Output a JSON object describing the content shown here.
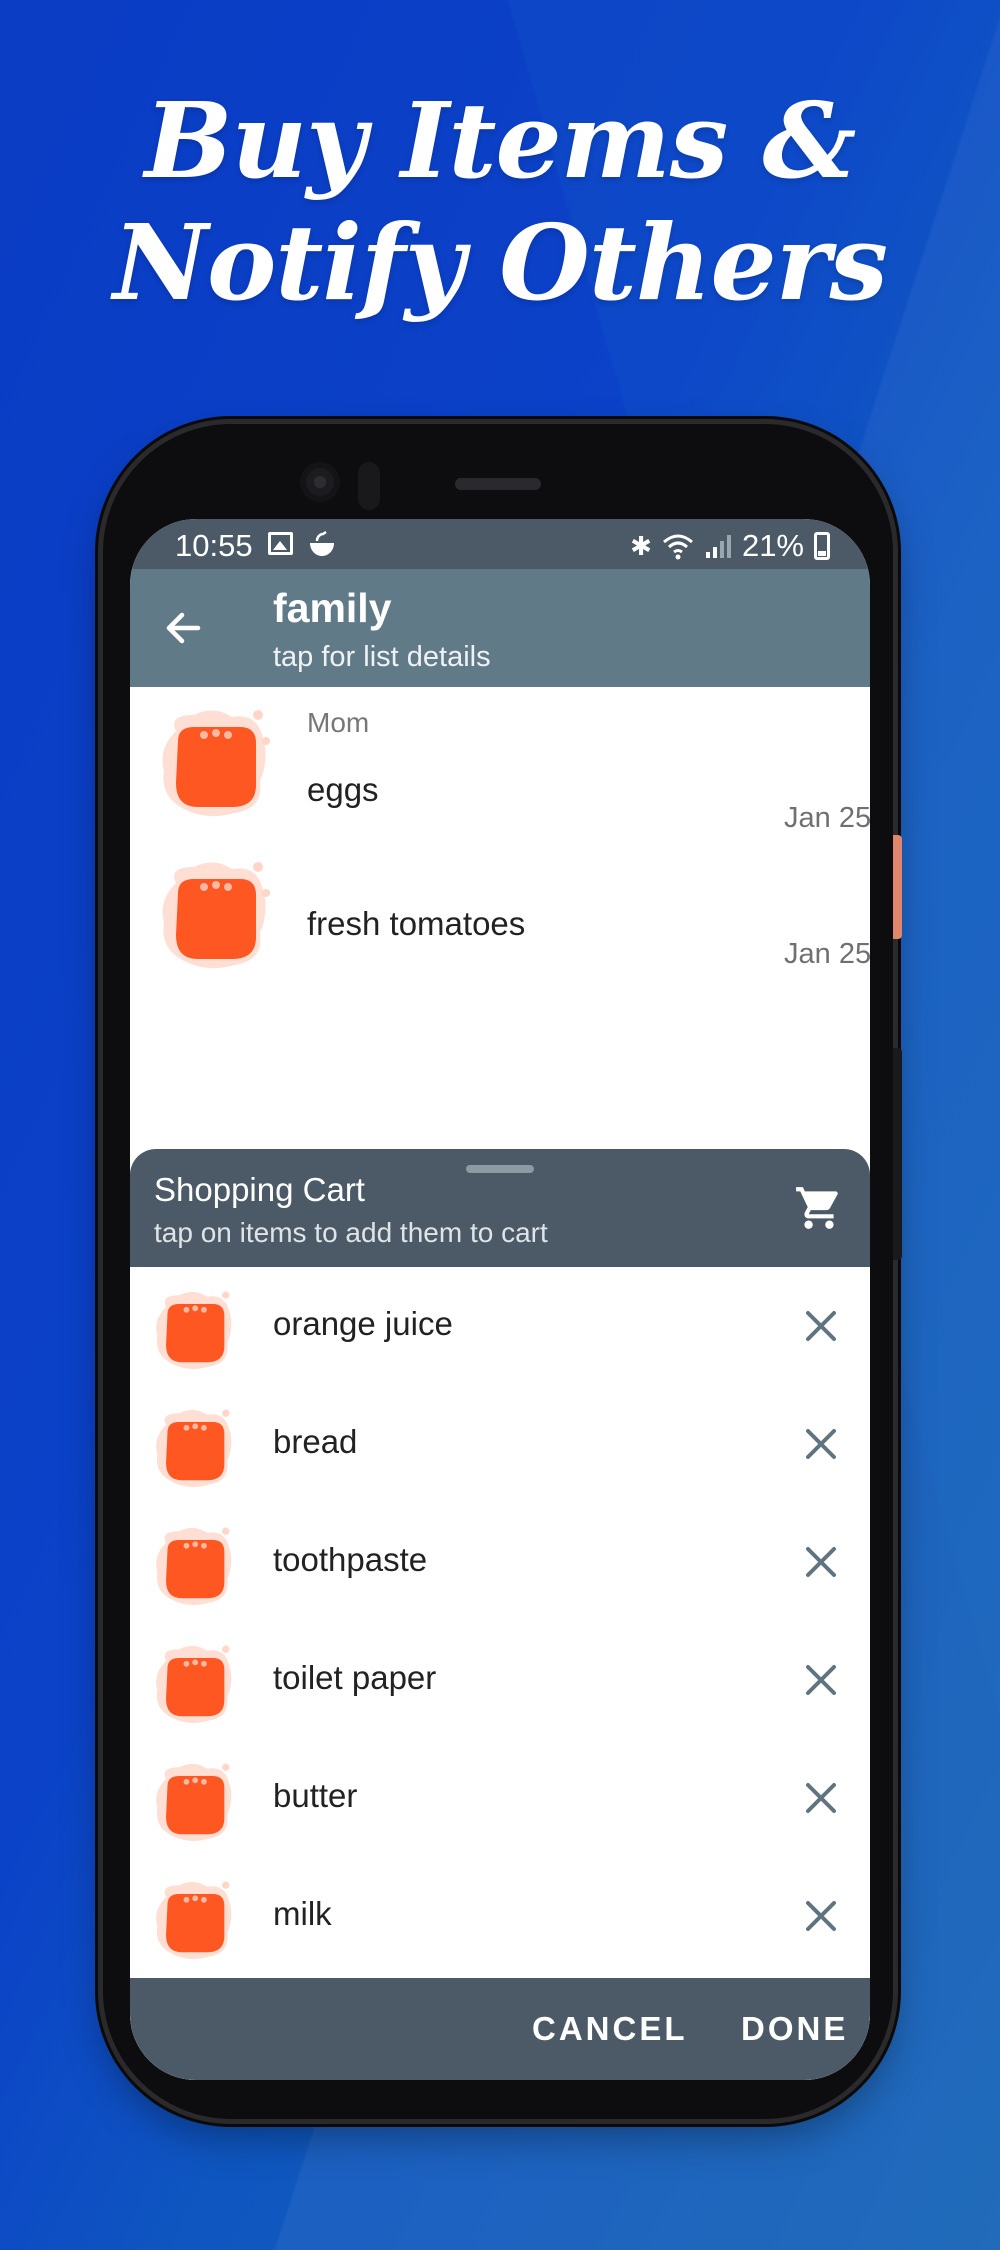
{
  "headline": {
    "line1": "Buy Items &",
    "line2": "Notify Others"
  },
  "status_bar": {
    "time": "10:55",
    "battery": "21%"
  },
  "app_bar": {
    "title": "family",
    "subtitle": "tap for list details"
  },
  "list_items": [
    {
      "owner": "Mom",
      "name": "eggs",
      "date": "Jan 25"
    },
    {
      "owner": "",
      "name": "fresh tomatoes",
      "date": "Jan 25"
    }
  ],
  "shopping_cart": {
    "title": "Shopping Cart",
    "subtitle": "tap on items to add them to cart",
    "items": [
      {
        "label": "orange juice"
      },
      {
        "label": "bread"
      },
      {
        "label": "toothpaste"
      },
      {
        "label": "toilet paper"
      },
      {
        "label": "butter"
      },
      {
        "label": "milk"
      }
    ]
  },
  "footer": {
    "cancel_label": "CANCEL",
    "done_label": "DONE"
  },
  "colors": {
    "background": "#0b42c8",
    "app_bar": "#617a88",
    "sheet_header": "#4b5a66",
    "avatar_main": "#ff5722",
    "avatar_splash": "#ffd6c8"
  }
}
